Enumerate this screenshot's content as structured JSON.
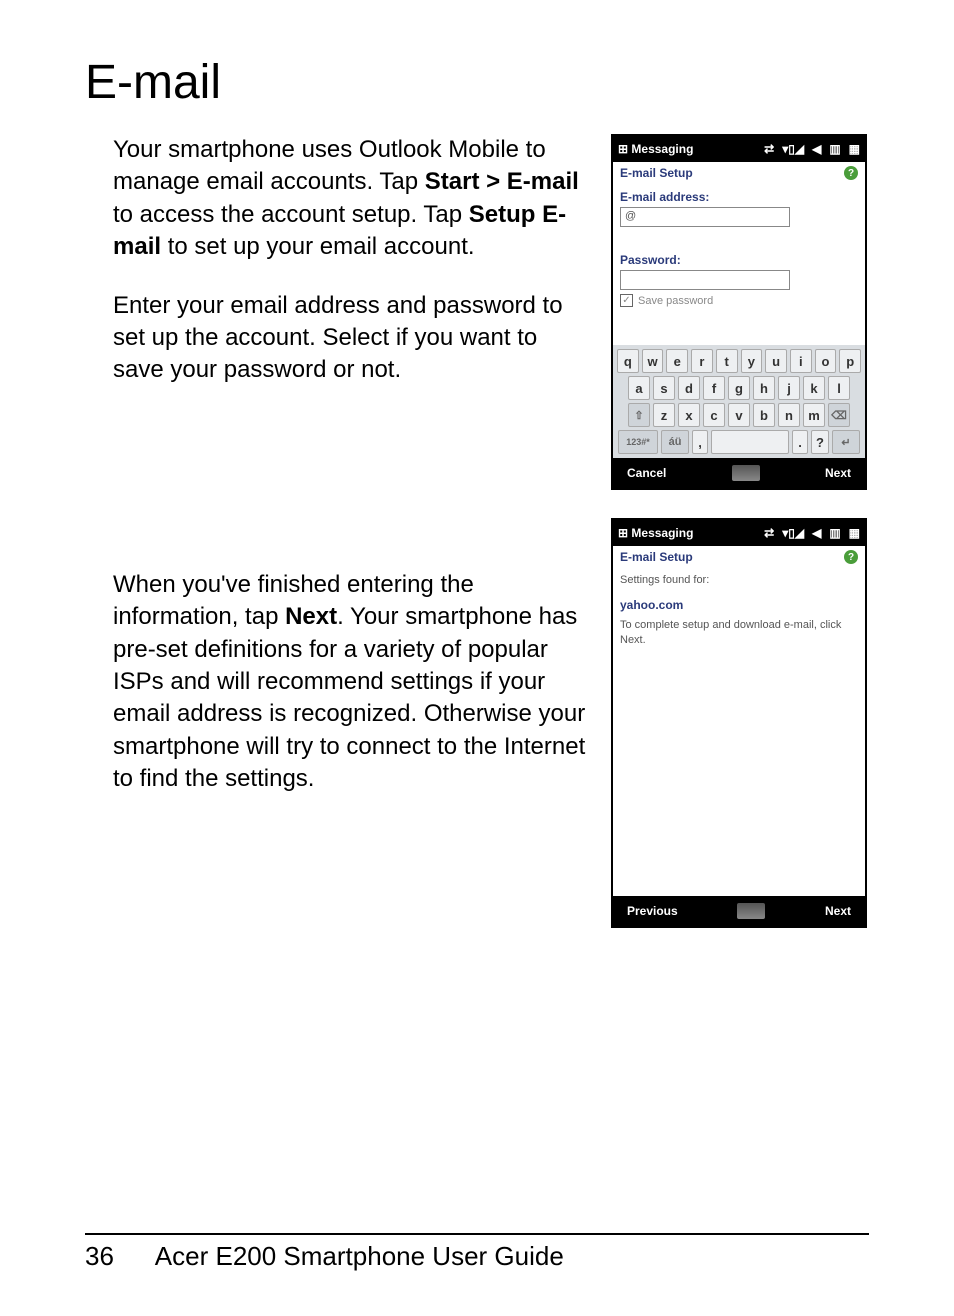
{
  "page": {
    "heading": "E-mail",
    "para1_pre": "Your smartphone uses Outlook Mobile to manage email accounts. Tap ",
    "para1_b1": "Start > E-mail",
    "para1_mid": " to access the account setup. Tap ",
    "para1_b2": "Setup E-mail",
    "para1_post": " to set up your email account.",
    "para2": "Enter your email address and password to set up the account. Select if you want to save your password or not.",
    "para3_pre": "When you've finished entering the information, tap ",
    "para3_b1": "Next",
    "para3_post": ". Your smartphone has pre-set definitions for a variety of popular ISPs and will recommend settings if your email address is recognized. Otherwise your smartphone will try to connect to the Internet to find the settings."
  },
  "phone1": {
    "title": "Messaging",
    "setup_header": "E-mail Setup",
    "email_label": "E-mail address:",
    "email_value": "@",
    "password_label": "Password:",
    "save_password": "Save password",
    "cancel": "Cancel",
    "next": "Next",
    "kb_row1": [
      "q",
      "w",
      "e",
      "r",
      "t",
      "y",
      "u",
      "i",
      "o",
      "p"
    ],
    "kb_row2": [
      "a",
      "s",
      "d",
      "f",
      "g",
      "h",
      "j",
      "k",
      "l"
    ],
    "kb_row3": [
      "⇧",
      "z",
      "x",
      "c",
      "v",
      "b",
      "n",
      "m",
      "⌫"
    ],
    "kb_row4": [
      "123#*",
      "áü",
      ",",
      "space",
      ".",
      "?",
      "↵"
    ]
  },
  "phone2": {
    "title": "Messaging",
    "setup_header": "E-mail Setup",
    "settings_found": "Settings found for:",
    "provider": "yahoo.com",
    "complete": "To complete setup and download e-mail, click Next.",
    "previous": "Previous",
    "next": "Next"
  },
  "footer": {
    "page_number": "36",
    "guide_title": "Acer E200 Smartphone User Guide"
  }
}
